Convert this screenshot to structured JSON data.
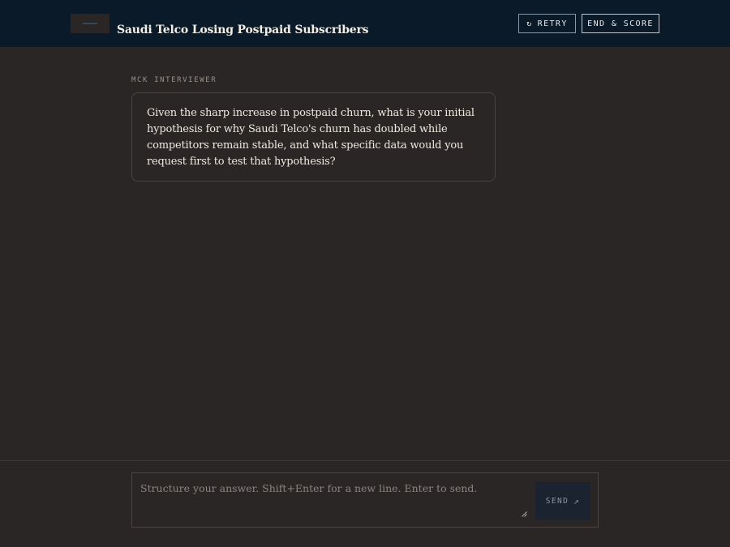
{
  "header": {
    "title": "Saudi Telco Losing Postpaid Subscribers",
    "retry_label": "RETRY",
    "retry_icon": "↻",
    "end_label": "END & SCORE"
  },
  "conversation": {
    "speaker": "MCK INTERVIEWER",
    "message": "Given the sharp increase in postpaid churn, what is your initial hypothesis for why Saudi Telco's churn has doubled while competitors remain stable, and what specific data would you request first to test that hypothesis?"
  },
  "composer": {
    "placeholder": "Structure your answer. Shift+Enter for a new line. Enter to send.",
    "value": "",
    "send_label": "SEND",
    "send_icon": "↗"
  },
  "colors": {
    "header_bg": "#0b1a28",
    "page_bg": "#2a2626",
    "send_bg": "#1b2330"
  }
}
